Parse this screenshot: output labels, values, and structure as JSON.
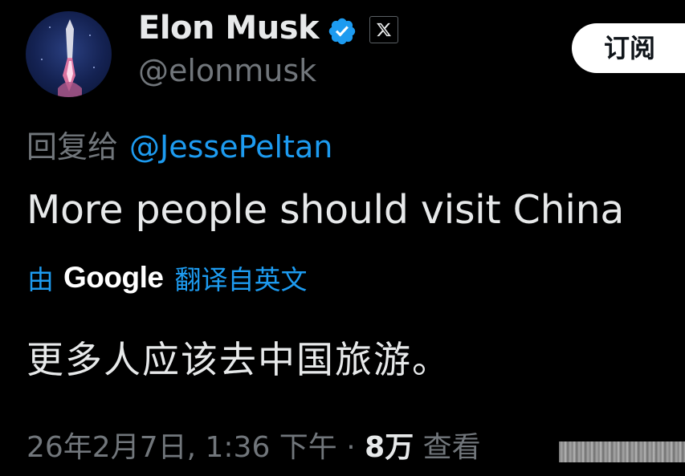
{
  "profile": {
    "display_name": "Elon Musk",
    "handle": "@elonmusk",
    "verified_icon": "verified-badge-icon",
    "affiliation_icon": "x-logo-icon",
    "avatar_icon": "rocket-launch-avatar"
  },
  "actions": {
    "subscribe_label": "订阅"
  },
  "reply": {
    "prefix": "回复给",
    "target": "@JessePeltan"
  },
  "tweet": {
    "text": "More people should visit China"
  },
  "translation": {
    "by_label": "由",
    "provider": "Google",
    "suffix": "翻译自英文",
    "text": "更多人应该去中国旅游。"
  },
  "meta": {
    "date_time": "26年2月7日, 1:36 下午 ·",
    "views_count": "8万",
    "views_label": "查看"
  },
  "colors": {
    "background": "#000000",
    "primary_text": "#e7e9ea",
    "secondary_text": "#71767b",
    "link_blue": "#1d9bf0",
    "verified_blue": "#1d9bf0",
    "button_bg": "#ffffff"
  }
}
